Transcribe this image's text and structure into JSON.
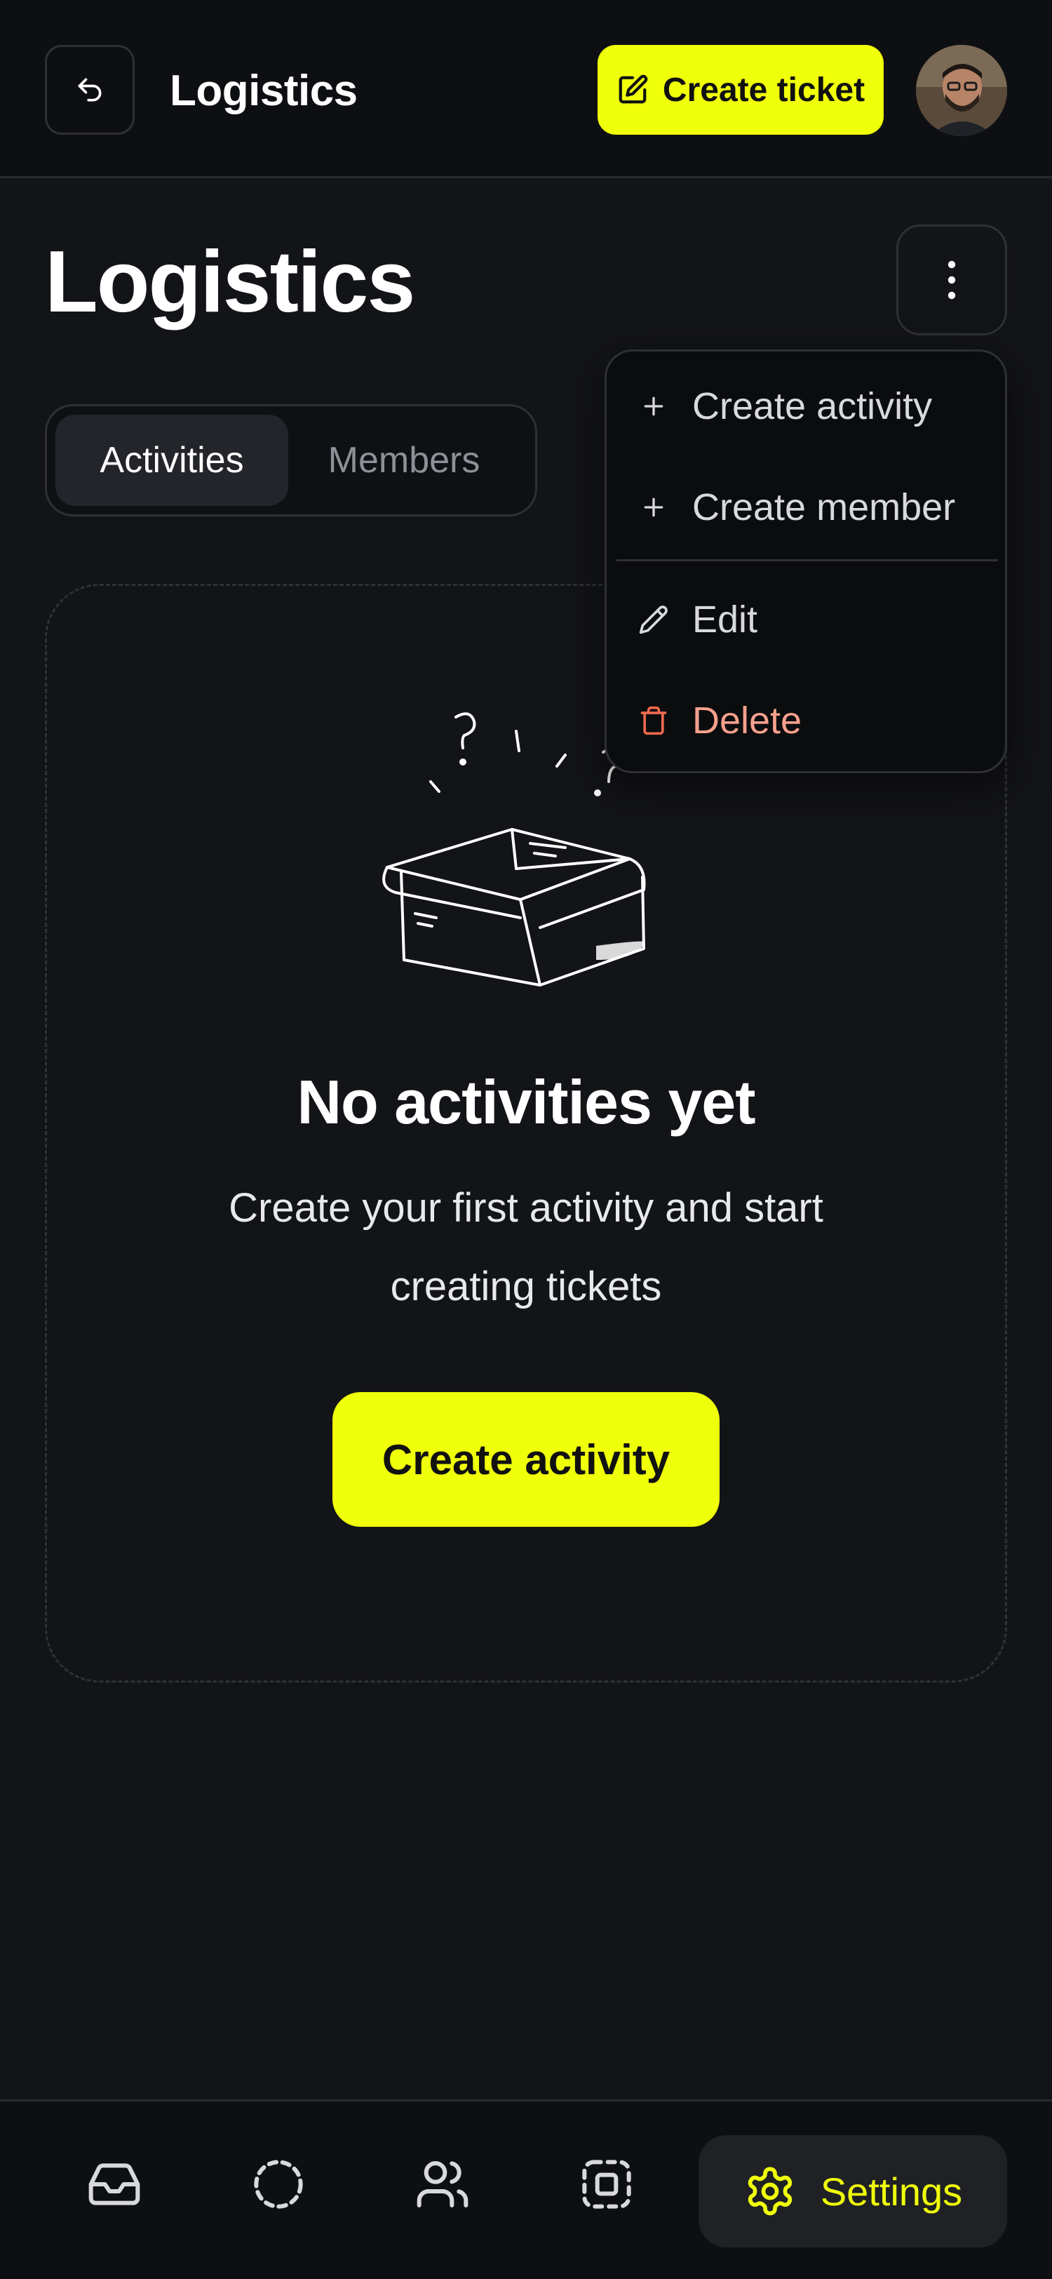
{
  "header": {
    "back_icon": "undo-arrow-icon",
    "title": "Logistics",
    "create_ticket_label": "Create ticket",
    "create_ticket_icon": "edit-square-icon",
    "avatar_icon": "user-avatar"
  },
  "page": {
    "title": "Logistics",
    "more_icon": "more-vertical-icon"
  },
  "tabs": [
    {
      "label": "Activities",
      "active": true
    },
    {
      "label": "Members",
      "active": false
    }
  ],
  "empty_state": {
    "illustration": "open-box-illustration",
    "title": "No activities yet",
    "description": "Create your first activity and start creating tickets",
    "cta_label": "Create activity"
  },
  "menu": {
    "items": [
      {
        "label": "Create activity",
        "icon": "plus-icon"
      },
      {
        "label": "Create member",
        "icon": "plus-icon"
      },
      {
        "label": "Edit",
        "icon": "pencil-icon"
      },
      {
        "label": "Delete",
        "icon": "trash-icon",
        "color": "#f6a08d"
      }
    ]
  },
  "bottom_nav": {
    "items": [
      {
        "icon": "inbox-icon"
      },
      {
        "icon": "dashed-circle-icon"
      },
      {
        "icon": "users-icon"
      },
      {
        "icon": "dashed-square-icon"
      }
    ],
    "settings_label": "Settings",
    "settings_icon": "gear-icon"
  },
  "colors": {
    "accent": "#f0ff0a",
    "background": "#131418",
    "danger": "#f6a08d"
  }
}
